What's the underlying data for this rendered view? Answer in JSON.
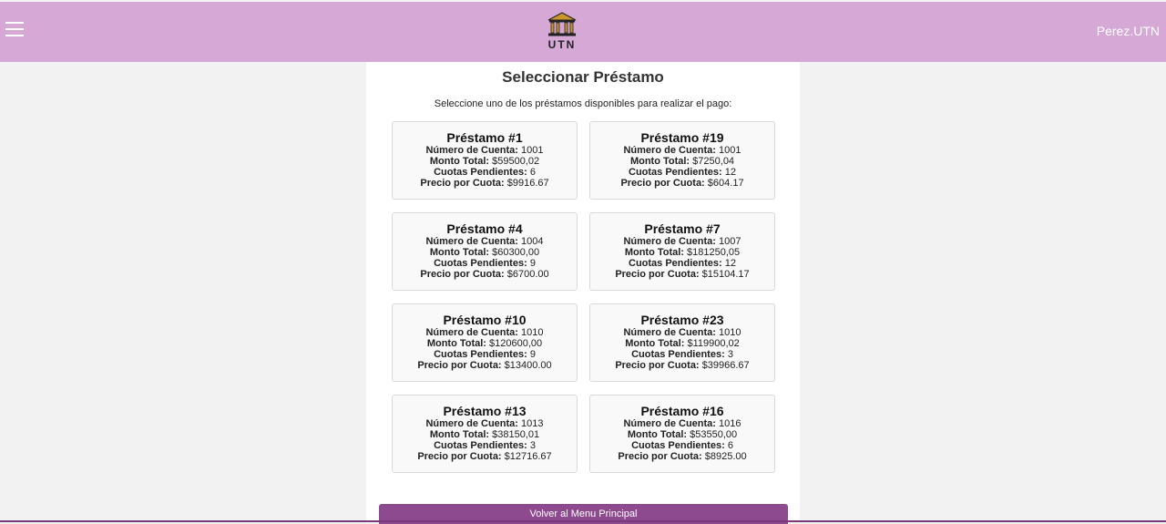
{
  "header": {
    "logo_text": "UTN",
    "user": "Perez.UTN"
  },
  "panel": {
    "title": "Seleccionar Préstamo",
    "subtitle": "Seleccione uno de los préstamos disponibles para realizar el pago:",
    "back_button": "Volver al Menu Principal"
  },
  "labels": {
    "cuenta": "Número de Cuenta:",
    "monto": "Monto Total:",
    "cuotas": "Cuotas Pendientes:",
    "precio": "Precio por Cuota:"
  },
  "loans": [
    {
      "title": "Préstamo #1",
      "cuenta": "1001",
      "monto": "$59500,02",
      "cuotas": "6",
      "precio": "$9916.67"
    },
    {
      "title": "Préstamo #19",
      "cuenta": "1001",
      "monto": "$7250,04",
      "cuotas": "12",
      "precio": "$604.17"
    },
    {
      "title": "Préstamo #4",
      "cuenta": "1004",
      "monto": "$60300,00",
      "cuotas": "9",
      "precio": "$6700.00"
    },
    {
      "title": "Préstamo #7",
      "cuenta": "1007",
      "monto": "$181250,05",
      "cuotas": "12",
      "precio": "$15104.17"
    },
    {
      "title": "Préstamo #10",
      "cuenta": "1010",
      "monto": "$120600,00",
      "cuotas": "9",
      "precio": "$13400.00"
    },
    {
      "title": "Préstamo #23",
      "cuenta": "1010",
      "monto": "$119900,02",
      "cuotas": "3",
      "precio": "$39966.67"
    },
    {
      "title": "Préstamo #13",
      "cuenta": "1013",
      "monto": "$38150,01",
      "cuotas": "3",
      "precio": "$12716.67"
    },
    {
      "title": "Préstamo #16",
      "cuenta": "1016",
      "monto": "$53550,00",
      "cuotas": "6",
      "precio": "$8925.00"
    }
  ],
  "colors": {
    "header_bg": "#d6a8d6",
    "button_bg": "#8e4a8e"
  }
}
